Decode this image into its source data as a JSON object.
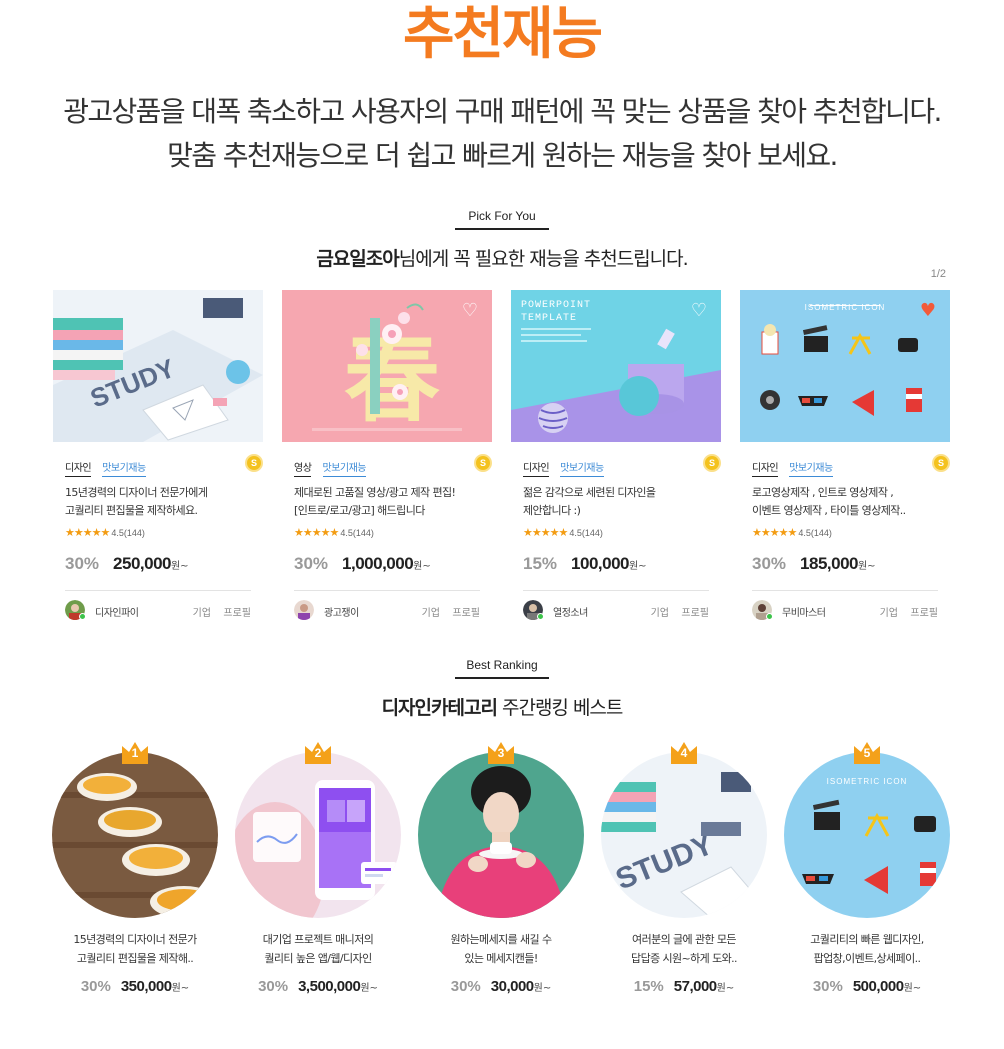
{
  "header": {
    "title": "추천재능",
    "subtitle_line1": "광고상품을 대폭 축소하고 사용자의 구매 패턴에 꼭 맞는 상품을 찾아 추천합니다.",
    "subtitle_line2": "맞춤 추천재능으로 더 쉽고 빠르게 원하는 재능을 찾아 보세요."
  },
  "pick": {
    "tag": "Pick For You",
    "user_name": "금요일조아",
    "title_rest": "님에게 꼭 필요한 재능을 추천드립니다.",
    "pager": "1/2",
    "cards": [
      {
        "category": "디자인",
        "preview": "맛보기재능",
        "coin": "S",
        "desc": "15년경력의 디자이너 전문가에게\n고퀄리티 편집물을 제작하세요.",
        "stars": "★★★★★",
        "rating": "4.5(144)",
        "discount": "30%",
        "price": "250,000",
        "won": "원~",
        "seller": "디자인파이",
        "seller_type": "기업",
        "profile": "프로필",
        "heart": ""
      },
      {
        "category": "영상",
        "preview": "맛보기재능",
        "coin": "S",
        "desc": "제대로된 고품질 영상/광고 제작 편집!\n[인트로/로고/광고] 해드립니다",
        "stars": "★★★★★",
        "rating": "4.5(144)",
        "discount": "30%",
        "price": "1,000,000",
        "won": "원~",
        "seller": "광고쟁이",
        "seller_type": "기업",
        "profile": "프로필",
        "heart": "♡"
      },
      {
        "category": "디자인",
        "preview": "맛보기재능",
        "coin": "S",
        "desc": "젊은 감각으로 세련된 디자인을\n제안합니다 :)",
        "stars": "★★★★★",
        "rating": "4.5(144)",
        "discount": "15%",
        "price": "100,000",
        "won": "원~",
        "seller": "열정소녀",
        "seller_type": "기업",
        "profile": "프로필",
        "heart": "♡",
        "thumb_title": "POWERPOINT\nTEMPLATE"
      },
      {
        "category": "디자인",
        "preview": "맛보기재능",
        "coin": "S",
        "desc": "로고영상제작 , 인트로 영상제작 ,\n이벤트 영상제작 , 타이틀 영상제작..",
        "stars": "★★★★★",
        "rating": "4.5(144)",
        "discount": "30%",
        "price": "185,000",
        "won": "원~",
        "seller": "무비마스터",
        "seller_type": "기업",
        "profile": "프로필",
        "heart": "♥",
        "thumb_title": "ISOMETRIC ICON"
      }
    ]
  },
  "ranking": {
    "tag": "Best Ranking",
    "title_bold": "디자인카테고리",
    "title_rest": " 주간랭킹 베스트",
    "items": [
      {
        "rank": "1",
        "desc": "15년경력의 디자이너 전문가\n고퀄리티 편집물을 제작해..",
        "discount": "30%",
        "price": "350,000",
        "won": "원~"
      },
      {
        "rank": "2",
        "desc": "대기업 프로젝트 매니저의\n퀄리티 높은 앱/웹/디자인",
        "discount": "30%",
        "price": "3,500,000",
        "won": "원~"
      },
      {
        "rank": "3",
        "desc": "원하는메세지를 새길 수\n있는 메세지캔들!",
        "discount": "30%",
        "price": "30,000",
        "won": "원~"
      },
      {
        "rank": "4",
        "desc": "여러분의 글에 관한 모든\n답답증 시원~하게 도와..",
        "discount": "15%",
        "price": "57,000",
        "won": "원~"
      },
      {
        "rank": "5",
        "desc": "고퀄리티의 빠른 웹디자인,\n팝업창,이벤트,상세페이..",
        "discount": "30%",
        "price": "500,000",
        "won": "원~",
        "circle_title": "ISOMETRIC ICON"
      }
    ]
  },
  "colors": {
    "accent": "#f47b20",
    "preview": "#3d8bd6",
    "star": "#f39c12",
    "crown": "#f4a11a"
  }
}
